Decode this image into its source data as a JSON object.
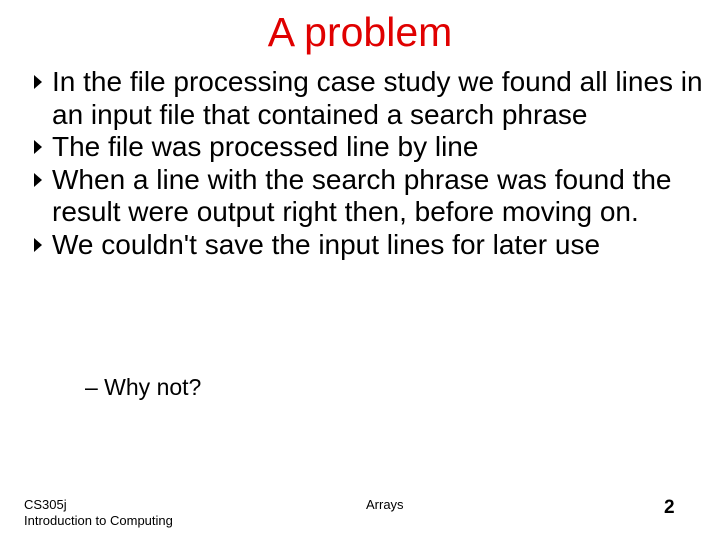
{
  "slide": {
    "title": "A problem",
    "title_color": "#e00000",
    "bullets": [
      {
        "text": "In the file processing case study we found all lines in an input file that contained a search phrase"
      },
      {
        "text": "The file was processed line by line"
      },
      {
        "text": "When a line with the search phrase was found the result were output right then, before moving on."
      },
      {
        "text": "We couldn't save the input lines for later use"
      }
    ],
    "sub_bullet": "– Why not?"
  },
  "footer": {
    "course": "CS305j",
    "course_name": "Introduction to Computing",
    "topic": "Arrays",
    "page_number": "2"
  }
}
